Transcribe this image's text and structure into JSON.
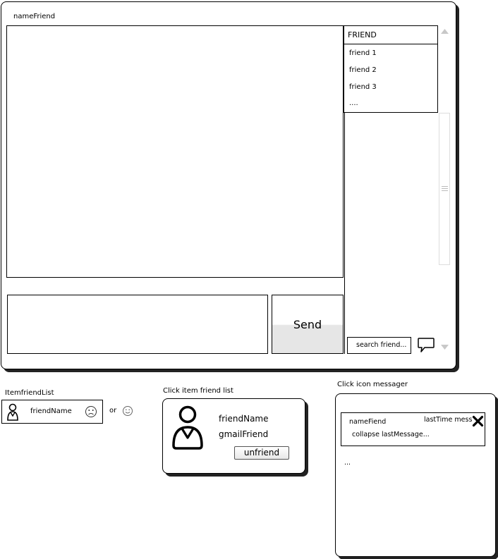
{
  "main": {
    "title": "nameFriend",
    "send_label": "Send",
    "search_placeholder": "search friend...",
    "dropdown": {
      "header": "FRIEND",
      "items": [
        "friend 1",
        "friend 2",
        "friend 3",
        "...."
      ]
    }
  },
  "item_friend_list": {
    "caption": "ItemfriendList",
    "name": "friendName",
    "or_label": "or"
  },
  "profile_card": {
    "caption": "Click item friend list",
    "name": "friendName",
    "email": "gmailFriend",
    "unfriend_label": "unfriend"
  },
  "messenger_card": {
    "caption": "Click icon messager",
    "name": "nameFiend",
    "last_time": "lastTime mess",
    "last_message": "collapse lastMessage...",
    "more": "..."
  },
  "icons": [
    "avatar-icon",
    "sad-face-icon",
    "smile-face-icon",
    "chat-bubble-icon",
    "close-icon",
    "scroll-up-icon",
    "scroll-down-icon"
  ]
}
